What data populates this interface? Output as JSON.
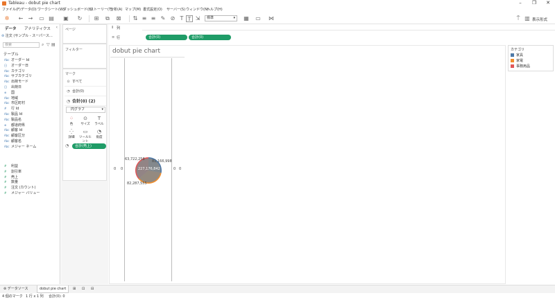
{
  "window": {
    "title": "Tableau - dobut pie chart"
  },
  "menu": [
    "ファイル(F)",
    "データ(D)",
    "ワークシート(W)",
    "ダッシュボード(B)",
    "ストーリー(T)",
    "分析(A)",
    "マップ(M)",
    "書式設定(O)",
    "サーバー(S)",
    "ウィンドウ(N)",
    "ヘルプ(H)"
  ],
  "toolbar": {
    "fit_select": "標準",
    "present_label": "表示形式"
  },
  "left_pane": {
    "tab_data": "データ",
    "tab_analytics": "アナリティクス",
    "source": "注文 (サンプル - スーパース…",
    "search_placeholder": "検索",
    "tables_label": "テーブル",
    "dimensions": [
      {
        "icon": "Abc",
        "label": "オーダー Id"
      },
      {
        "icon": "日",
        "label": "オーダー日"
      },
      {
        "icon": "Abc",
        "label": "カテゴリ"
      },
      {
        "icon": "Abc",
        "label": "サブカテゴリ"
      },
      {
        "icon": "Abc",
        "label": "出荷モード"
      },
      {
        "icon": "日",
        "label": "出荷日"
      },
      {
        "icon": "⊕",
        "label": "国"
      },
      {
        "icon": "Abc",
        "label": "地域"
      },
      {
        "icon": "Abc",
        "label": "市区町村"
      },
      {
        "icon": "#",
        "label": "行 Id"
      },
      {
        "icon": "Abc",
        "label": "製品 Id"
      },
      {
        "icon": "Abc",
        "label": "製品名"
      },
      {
        "icon": "⊕",
        "label": "都道府県"
      },
      {
        "icon": "Abc",
        "label": "顧客 Id"
      },
      {
        "icon": "Abc",
        "label": "顧客区分"
      },
      {
        "icon": "Abc",
        "label": "顧客名"
      },
      {
        "icon": "Abc",
        "label": "メジャー ネーム"
      }
    ],
    "measures": [
      {
        "icon": "#",
        "label": "利益"
      },
      {
        "icon": "#",
        "label": "割引率"
      },
      {
        "icon": "#",
        "label": "売上"
      },
      {
        "icon": "#",
        "label": "数量"
      },
      {
        "icon": "#",
        "label": "注文 (カウント)"
      },
      {
        "icon": "#",
        "label": "メジャー バリュー"
      }
    ]
  },
  "pages_label": "ページ",
  "filters_label": "フィルター",
  "marks": {
    "title": "マーク",
    "rows": [
      "すべて",
      "合計(0)",
      "合計(0) (2)"
    ],
    "mark_type": "円グラフ",
    "buttons": [
      "色",
      "サイズ",
      "ラベル",
      "詳細",
      "ツールヒント",
      "角度"
    ],
    "angle_pill": "合計(売上)"
  },
  "shelves": {
    "columns_label": "列",
    "rows_label": "行",
    "row_pills": [
      "合計(0)",
      "合計(0)"
    ]
  },
  "sheet": {
    "title": "dobut pie chart",
    "center_label": "227,176,842",
    "labels": [
      "63,722,258",
      "81,166,998",
      "82,287,555"
    ],
    "axis_zero": "0"
  },
  "chart_data": {
    "type": "pie",
    "categories": [
      "家具",
      "家電",
      "事務用品"
    ],
    "values": [
      63722258,
      81166998,
      82287555
    ],
    "total": 227176842,
    "colors": [
      "#4e79a7",
      "#f28e2b",
      "#e15759"
    ]
  },
  "legend": {
    "title": "カテゴリ",
    "items": [
      {
        "label": "家具",
        "color": "#4e79a7"
      },
      {
        "label": "家電",
        "color": "#f28e2b"
      },
      {
        "label": "事務用品",
        "color": "#e15759"
      }
    ]
  },
  "bottom_tabs": {
    "datasource": "データソース",
    "sheet": "dobut pie chart"
  },
  "status": {
    "marks": "4 個のマーク",
    "rows_cols": "1 行 x 1 列",
    "sum": "合計(0): 0"
  }
}
